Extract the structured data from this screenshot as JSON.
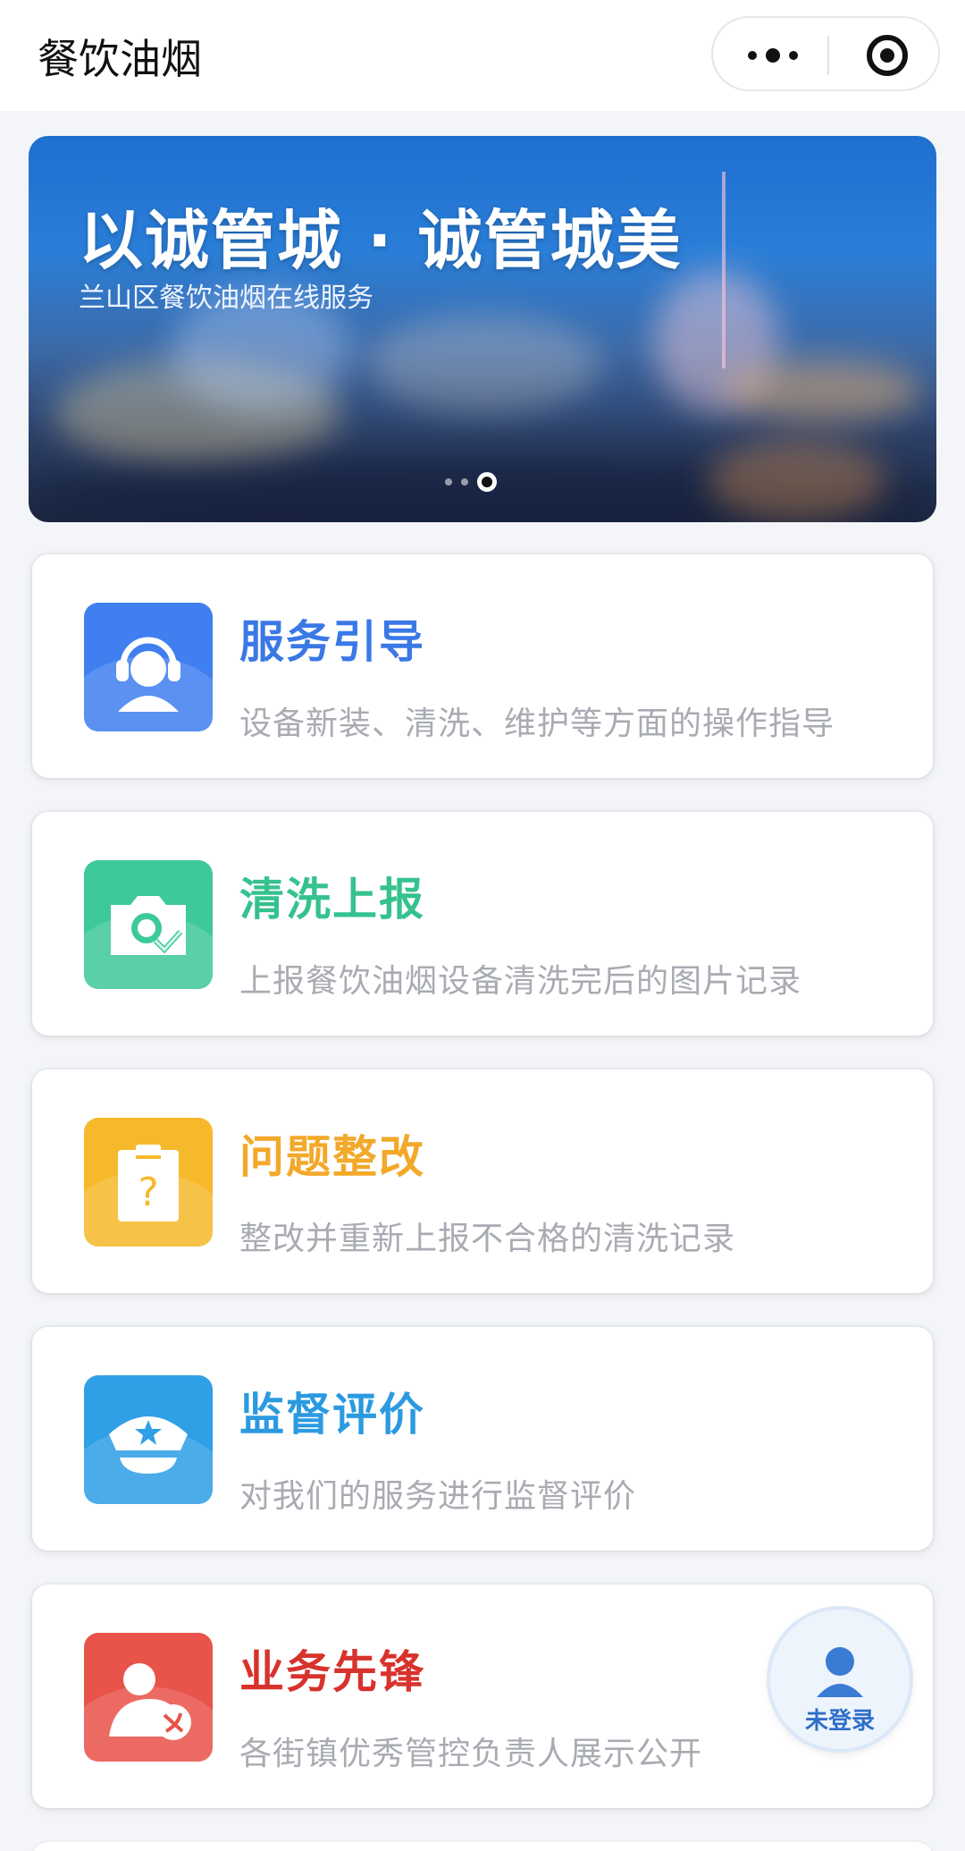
{
  "header": {
    "title": "餐饮油烟",
    "more_icon": "more-dots-icon",
    "close_icon": "target-close-icon"
  },
  "banner": {
    "title": "以诚管城 · 诚管城美",
    "subtitle": "兰山区餐饮油烟在线服务",
    "slide_count": 3,
    "active_slide": 3
  },
  "cards": [
    {
      "title": "服务引导",
      "desc": "设备新装、清洗、维护等方面的操作指导",
      "icon": "headset-agent-icon",
      "color": "#3f7ff0"
    },
    {
      "title": "清洗上报",
      "desc": "上报餐饮油烟设备清洗完后的图片记录",
      "icon": "camera-check-icon",
      "color": "#3ec99a"
    },
    {
      "title": "问题整改",
      "desc": "整改并重新上报不合格的清洗记录",
      "icon": "clipboard-question-icon",
      "color": "#f6b92b"
    },
    {
      "title": "监督评价",
      "desc": "对我们的服务进行监督评价",
      "icon": "police-cap-icon",
      "color": "#2f9fe6"
    },
    {
      "title": "业务先锋",
      "desc": "各街镇优秀管控负责人展示公开",
      "icon": "pioneer-person-icon",
      "color": "#e8534a"
    }
  ],
  "login": {
    "label": "未登录",
    "icon": "user-icon"
  }
}
